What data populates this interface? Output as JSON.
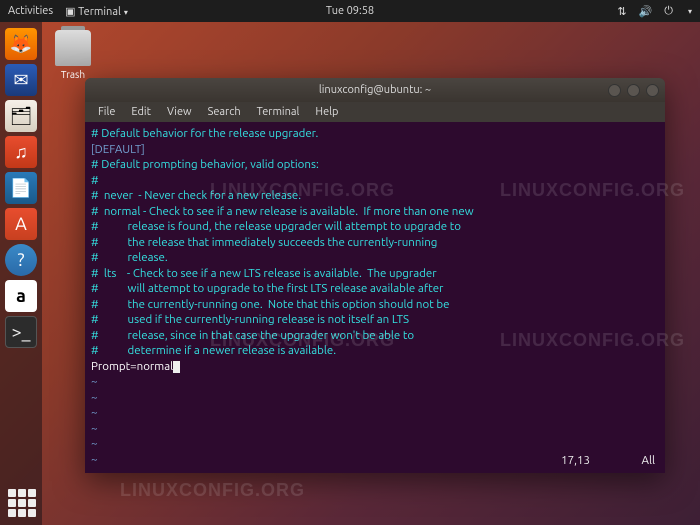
{
  "topbar": {
    "activities": "Activities",
    "app": "Terminal",
    "clock": "Tue 09:58"
  },
  "desktop": {
    "trash": "Trash"
  },
  "dock": {
    "items": [
      "firefox",
      "thunderbird",
      "files",
      "rhythmbox",
      "writer",
      "software",
      "help",
      "amazon",
      "terminal"
    ]
  },
  "window": {
    "title": "linuxconfig@ubuntu: ~",
    "menu": [
      "File",
      "Edit",
      "View",
      "Search",
      "Terminal",
      "Help"
    ],
    "lines": [
      "# Default behavior for the release upgrader.",
      "",
      "[DEFAULT]",
      "# Default prompting behavior, valid options:",
      "#",
      "#  never  - Never check for a new release.",
      "#  normal - Check to see if a new release is available.  If more than one new",
      "#           release is found, the release upgrader will attempt to upgrade to",
      "#           the release that immediately succeeds the currently-running",
      "#           release.",
      "#  lts    - Check to see if a new LTS release is available.  The upgrader",
      "#           will attempt to upgrade to the first LTS release available after",
      "#           the currently-running one.  Note that this option should not be",
      "#           used if the currently-running release is not itself an LTS",
      "#           release, since in that case the upgrader won't be able to",
      "#           determine if a newer release is available."
    ],
    "setting_key": "Prompt",
    "setting_val": "normal",
    "status_pos": "17,13",
    "status_pct": "All"
  },
  "watermark": "LINUXCONFIG.ORG"
}
